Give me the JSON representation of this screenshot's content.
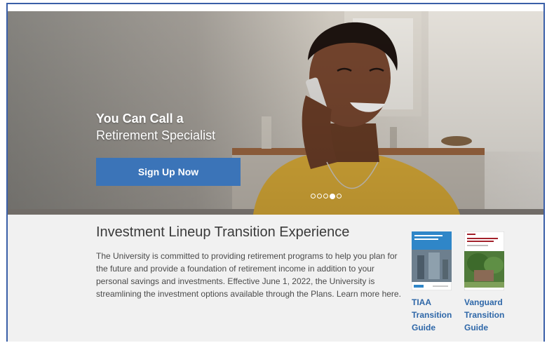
{
  "hero": {
    "title": "You Can Call a",
    "subtitle": "Retirement Specialist",
    "cta_label": "Sign Up Now",
    "carousel_slide_count": 5,
    "carousel_active_index": 3
  },
  "section": {
    "title": "Investment Lineup Transition Experience",
    "body": "The University is committed to providing retirement programs to help you plan for the future and provide a foundation of retirement income in addition to your personal savings and investments. Effective June 1, 2022, the University is streamlining the investment options available through the Plans. Learn more here."
  },
  "guides": [
    {
      "label": "TIAA\nTransition\nGuide",
      "brand": "TIAA"
    },
    {
      "label": "Vanguard\nTransition\nGuide",
      "brand": "Vanguard"
    }
  ],
  "colors": {
    "accent": "#3b74b8",
    "link": "#2e67a8",
    "frame_border": "#3a5fa8"
  }
}
